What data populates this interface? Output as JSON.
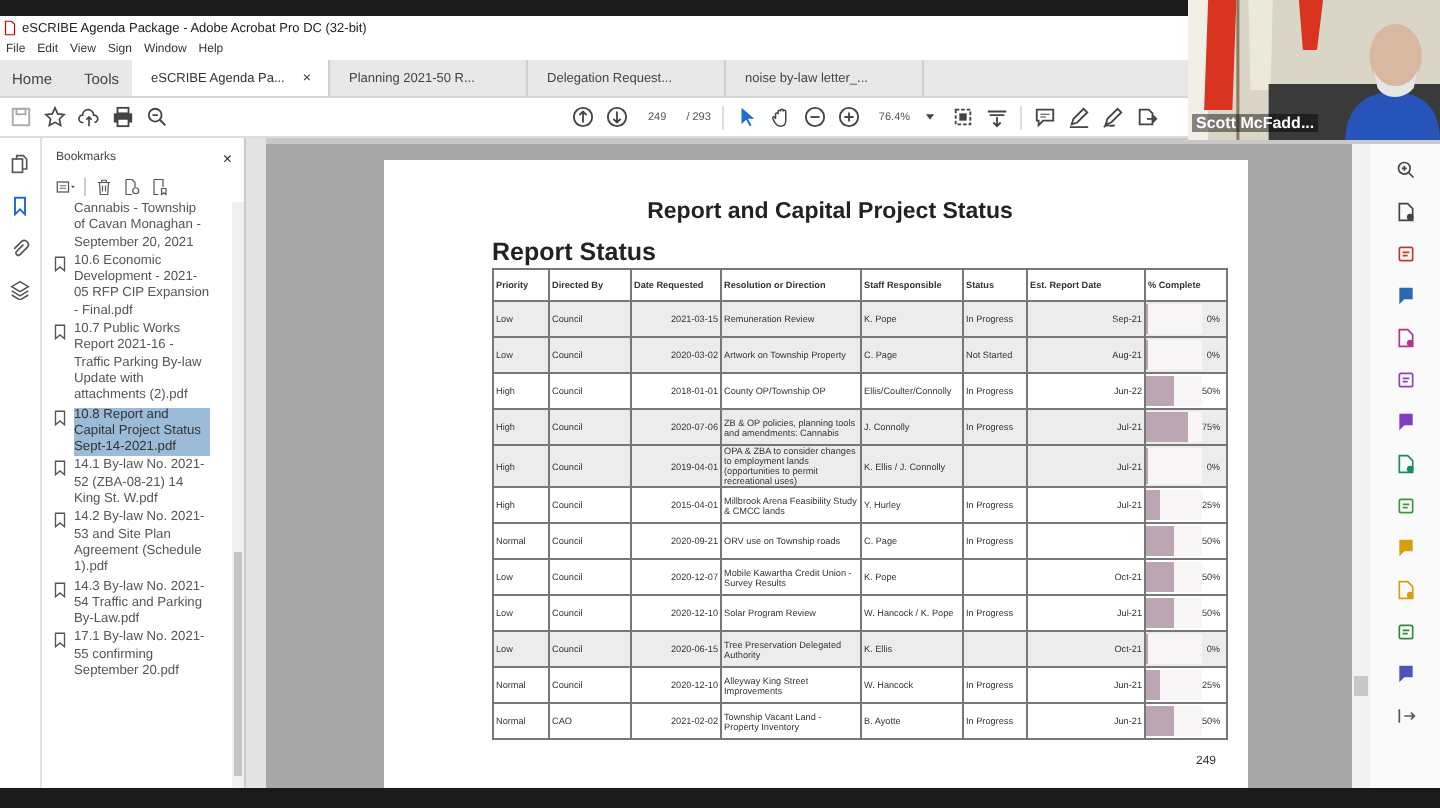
{
  "window": {
    "title": "eSCRIBE Agenda Package - Adobe Acrobat Pro DC (32-bit)"
  },
  "menu": [
    "File",
    "Edit",
    "View",
    "Sign",
    "Window",
    "Help"
  ],
  "nav_tabs": [
    "Home",
    "Tools"
  ],
  "doc_tabs": [
    {
      "label": "eSCRIBE Agenda Pa...",
      "selected": true,
      "close": "×"
    },
    {
      "label": "Planning 2021-50 R...",
      "selected": false
    },
    {
      "label": "Delegation Request...",
      "selected": false
    },
    {
      "label": "noise by-law letter_...",
      "selected": false
    }
  ],
  "toolbar": {
    "page": "249",
    "page_total": "/ 293",
    "zoom": "76.4%"
  },
  "bookmarks": {
    "title": "Bookmarks",
    "close": "×",
    "items": [
      {
        "kind": "continuation",
        "label": "Cannabis - Township of Cavan Monaghan - September 20, 2021",
        "selected": false
      },
      {
        "kind": "bookmark",
        "label": "10.6 Economic Development - 2021-05 RFP CIP Expansion - Final.pdf",
        "selected": false
      },
      {
        "kind": "bookmark",
        "label": "10.7 Public Works Report 2021-16 - Traffic  Parking By-law Update with attachments (2).pdf",
        "selected": false
      },
      {
        "kind": "bookmark",
        "label": "10.8 Report and Capital Project Status Sept-14-2021.pdf",
        "selected": true
      },
      {
        "kind": "bookmark",
        "label": "14.1 By-law No. 2021-52 (ZBA-08-21) 14 King St. W.pdf",
        "selected": false
      },
      {
        "kind": "bookmark",
        "label": "14.2 By-law No. 2021-53 and Site Plan Agreement (Schedule 1).pdf",
        "selected": false
      },
      {
        "kind": "bookmark",
        "label": "14.3 By-law No. 2021-54 Traffic and Parking By-Law.pdf",
        "selected": false
      },
      {
        "kind": "bookmark",
        "label": "17.1 By-law No. 2021-55 confirming September 20.pdf",
        "selected": false
      }
    ]
  },
  "document": {
    "heading": "Report and Capital Project Status",
    "section": "Report Status",
    "columns": [
      "Priority",
      "Directed By",
      "Date Requested",
      "Resolution or Direction",
      "Staff Responsible",
      "Status",
      "Est. Report Date",
      "% Complete"
    ],
    "rows": [
      {
        "priority": "Low",
        "directed_by": "Council",
        "date": "2021-03-15",
        "resolution": "Remuneration Review",
        "staff": "K. Pope",
        "status": "In Progress",
        "report_date": "Sep-21",
        "complete": "0%",
        "level": 0,
        "shaded": true
      },
      {
        "priority": "Low",
        "directed_by": "Council",
        "date": "2020-03-02",
        "resolution": "Artwork on Township Property",
        "staff": "C. Page",
        "status": "Not Started",
        "report_date": "Aug-21",
        "complete": "0%",
        "level": 0,
        "shaded": true
      },
      {
        "priority": "High",
        "directed_by": "Council",
        "date": "2018-01-01",
        "resolution": "County OP/Township OP",
        "staff": "Ellis/Coulter/Connolly",
        "status": "In Progress",
        "report_date": "Jun-22",
        "complete": "50%",
        "level": 0.5,
        "shaded": false
      },
      {
        "priority": "High",
        "directed_by": "Council",
        "date": "2020-07-06",
        "resolution": "ZB & OP policies, planning tools and amendments: Cannabis",
        "staff": "J. Connolly",
        "status": "In Progress",
        "report_date": "Jul-21",
        "complete": "75%",
        "level": 0.75,
        "shaded": true
      },
      {
        "priority": "High",
        "directed_by": "Council",
        "date": "2019-04-01",
        "resolution": "OPA & ZBA to consider changes to employment lands (opportunities to permit recreational uses)",
        "staff": "K. Ellis / J. Connolly",
        "report_date": "Jul-21",
        "complete": "0%",
        "level": 0,
        "shaded": true
      },
      {
        "priority": "High",
        "directed_by": "Council",
        "date": "2015-04-01",
        "resolution": "Millbrook Arena Feasibility Study & CMCC lands",
        "staff": "Y. Hurley",
        "status": "In Progress",
        "report_date": "Jul-21",
        "complete": "25%",
        "level": 0.25,
        "shaded": false
      },
      {
        "priority": "Normal",
        "directed_by": "Council",
        "date": "2020-09-21",
        "resolution": "ORV use on Township roads",
        "staff": "C. Page",
        "status": "In Progress",
        "complete": "50%",
        "level": 0.5,
        "shaded": false
      },
      {
        "priority": "Low",
        "directed_by": "Council",
        "date": "2020-12-07",
        "resolution": "Mobile Kawartha Credit Union - Survey Results",
        "staff": "K. Pope",
        "report_date": "Oct-21",
        "complete": "50%",
        "level": 0.5,
        "shaded": false
      },
      {
        "priority": "Low",
        "directed_by": "Council",
        "date": "2020-12-10",
        "resolution": "Solar Program Review",
        "staff": "W. Hancock / K. Pope",
        "status": "In Progress",
        "report_date": "Jul-21",
        "complete": "50%",
        "level": 0.5,
        "shaded": false
      },
      {
        "priority": "Low",
        "directed_by": "Council",
        "date": "2020-06-15",
        "resolution": "Tree Preservation Delegated Authority",
        "staff": "K. Ellis",
        "report_date": "Oct-21",
        "complete": "0%",
        "level": 0,
        "shaded": true
      },
      {
        "priority": "Normal",
        "directed_by": "Council",
        "date": "2020-12-10",
        "resolution": "Alleyway King Street Improvements",
        "staff": "W. Hancock",
        "status": "In Progress",
        "report_date": "Jun-21",
        "complete": "25%",
        "level": 0.25,
        "shaded": false
      },
      {
        "priority": "Normal",
        "directed_by": "CAO",
        "date": "2021-02-02",
        "resolution": "Township Vacant Land - Property Inventory",
        "staff": "B. Ayotte",
        "status": "In Progress",
        "report_date": "Jun-21",
        "complete": "50%",
        "level": 0.5,
        "shaded": false
      }
    ],
    "page_number": "249"
  },
  "video": {
    "name": "Scott McFadd..."
  }
}
